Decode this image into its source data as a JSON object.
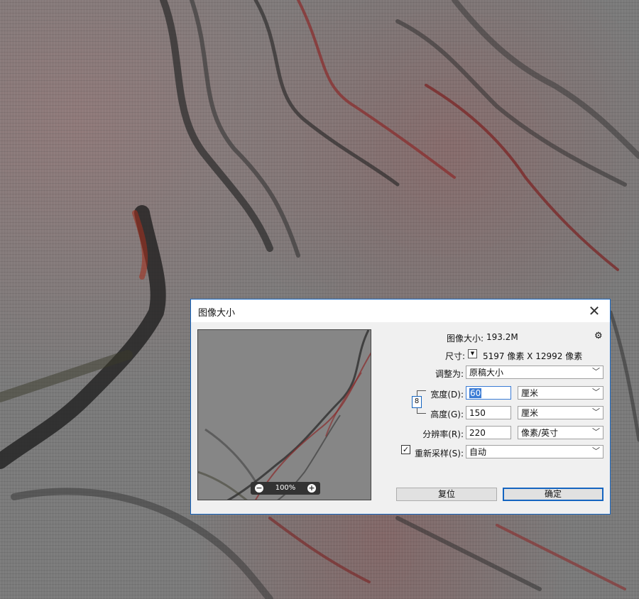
{
  "dialog": {
    "title": "图像大小",
    "image_size_label": "图像大小:",
    "image_size_value": "193.2M",
    "dimensions_label": "尺寸:",
    "dimensions_value": "5197 像素  X  12992 像素",
    "fit_to_label": "调整为:",
    "fit_to_value": "原稿大小",
    "width_label": "宽度(D):",
    "width_value": "60",
    "width_unit": "厘米",
    "height_label": "高度(G):",
    "height_value": "150",
    "height_unit": "厘米",
    "resolution_label": "分辨率(R):",
    "resolution_value": "220",
    "resolution_unit": "像素/英寸",
    "resample_label": "重新采样(S):",
    "resample_value": "自动",
    "resample_checked": "✓",
    "preview_zoom": "100%",
    "reset_button": "复位",
    "ok_button": "确定",
    "close_glyph": "✕",
    "gear_glyph": "⚙"
  }
}
